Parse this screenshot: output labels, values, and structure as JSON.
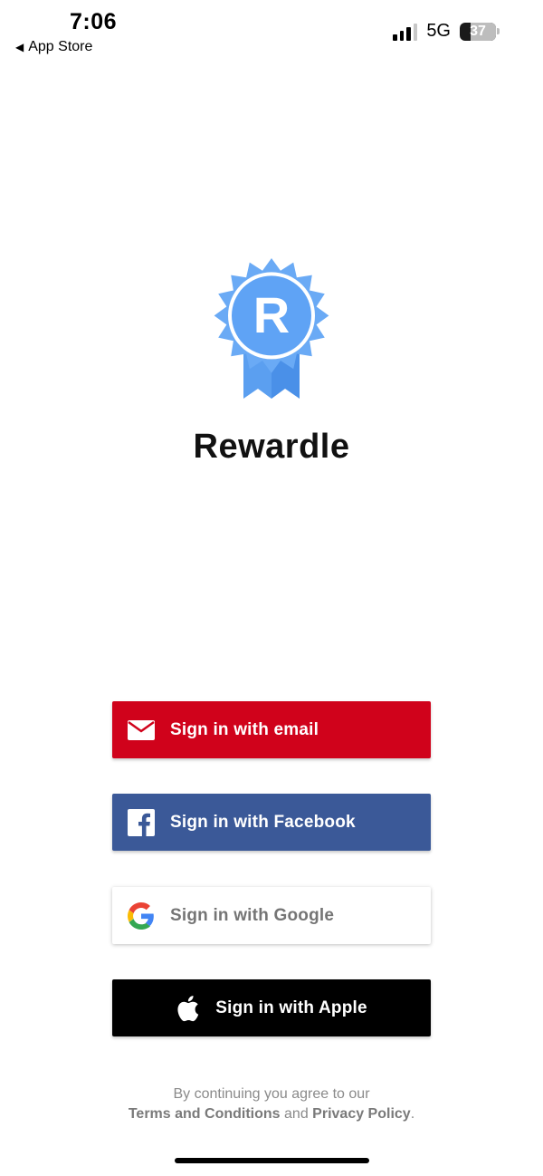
{
  "status_bar": {
    "time": "7:06",
    "back_label": "App Store",
    "network": "5G",
    "battery": "37"
  },
  "app": {
    "logo_letter": "R",
    "name": "Rewardle",
    "brand_color": "#5fa3f5"
  },
  "buttons": {
    "email": {
      "label": "Sign in with email",
      "color": "#d0021b",
      "icon": "envelope-icon"
    },
    "facebook": {
      "label": "Sign in with Facebook",
      "color": "#3b5998",
      "icon": "facebook-icon"
    },
    "google": {
      "label": "Sign in with Google",
      "color": "#ffffff",
      "icon": "google-icon"
    },
    "apple": {
      "label": "Sign in with Apple",
      "color": "#000000",
      "icon": "apple-icon"
    }
  },
  "legal": {
    "prefix": "By continuing you agree to our",
    "terms": "Terms and Conditions",
    "and": "and",
    "privacy": "Privacy Policy",
    "suffix": "."
  }
}
